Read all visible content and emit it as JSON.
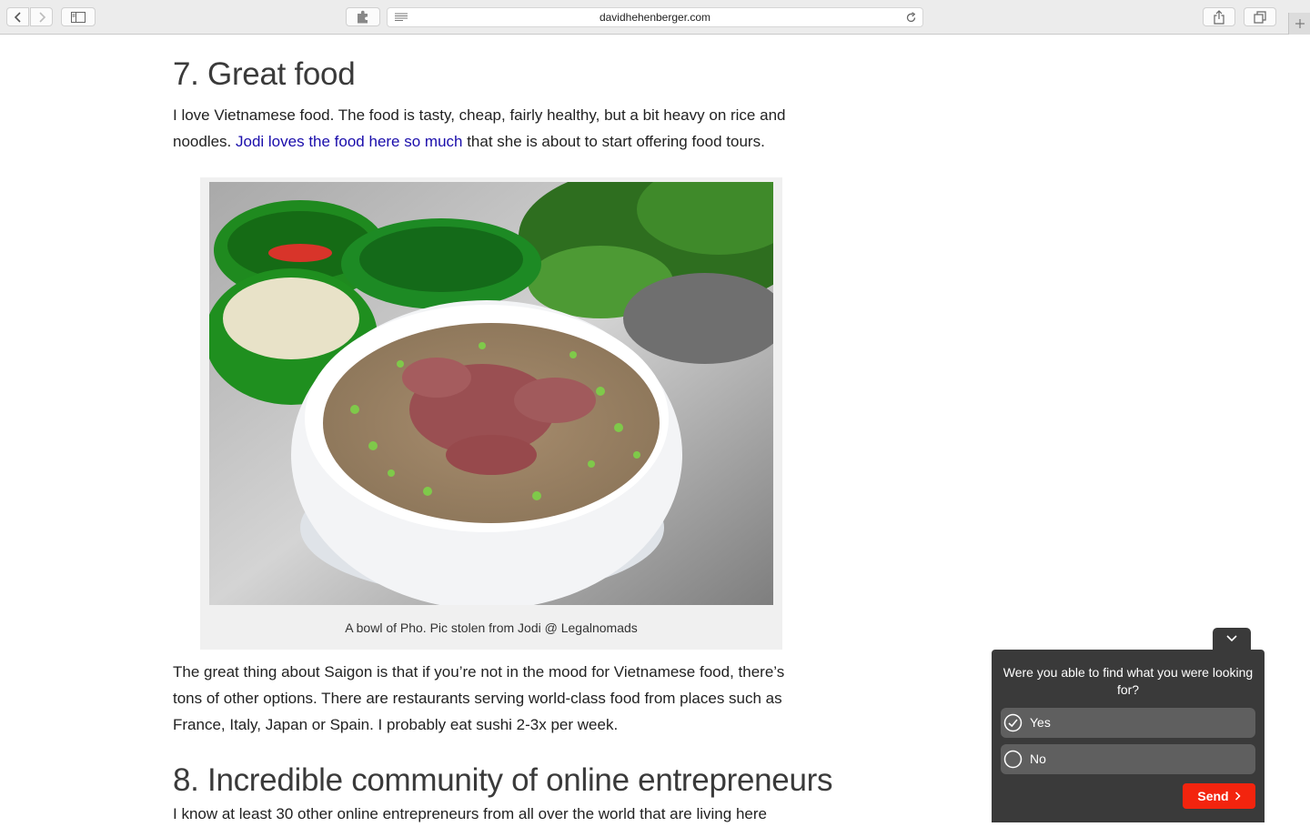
{
  "browser": {
    "url": "davidhehenberger.com",
    "icons": {
      "back": "chevron-left-icon",
      "forward": "chevron-right-icon",
      "sidebar": "sidebar-icon",
      "extension": "puzzle-icon",
      "reader": "reader-icon",
      "reload": "reload-icon",
      "share": "share-icon",
      "tabs": "tabs-overview-icon",
      "new_tab": "plus-icon"
    }
  },
  "article": {
    "section7_heading": "7. Great food",
    "section7_text_before_link": "I love Vietnamese food. The food is tasty, cheap, fairly healthy, but a bit heavy on rice and noodles. ",
    "section7_link": "Jodi loves the food here so much",
    "section7_text_after_link": " that she is about to start offering food tours.",
    "figure_caption": "A bowl of Pho. Pic stolen from Jodi @ Legalnomads",
    "saigon_paragraph": "The great thing about Saigon is that if you’re not in the mood for Vietnamese food, there’s tons of other options. There are restaurants serving world-class food from places such as France, Italy, Japan or Spain. I probably eat sushi 2-3x per week.",
    "section8_heading": "8. Incredible community of online entrepreneurs",
    "section8_text": "I know at least 30 other online entrepreneurs from all over the world that are living here"
  },
  "feedback_widget": {
    "question": "Were you able to find what you were looking for?",
    "options": [
      {
        "label": "Yes",
        "selected": true
      },
      {
        "label": "No",
        "selected": false
      }
    ],
    "send_label": "Send",
    "send_color": "#f3240e",
    "panel_color": "#3a3a3a"
  },
  "colors": {
    "link": "#1a0dab"
  }
}
